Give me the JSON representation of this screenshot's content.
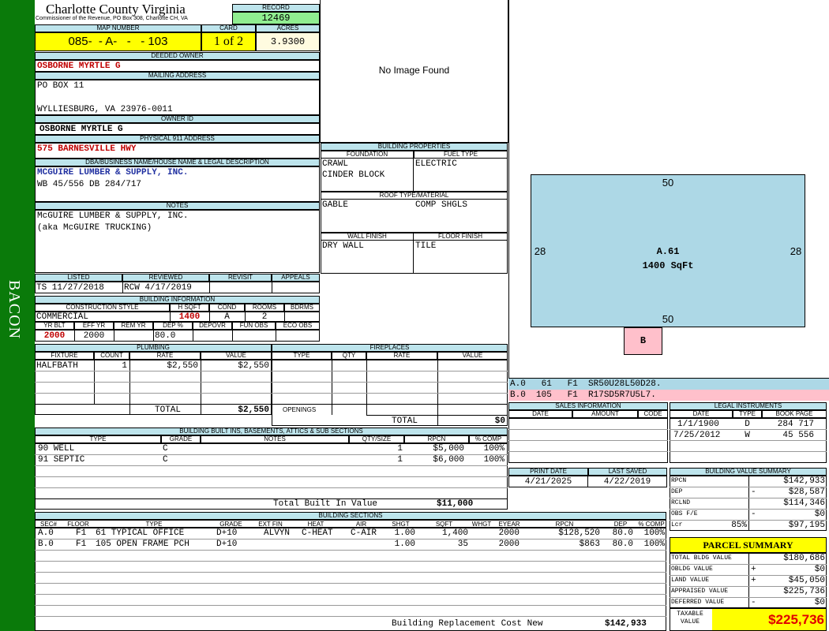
{
  "side_label": "BACON",
  "header": {
    "county": "Charlotte County Virginia",
    "commissioner": "Commissioner of the Revenue, PO Box 308, Charlotte CH, VA",
    "record_label": "RECORD",
    "record": "12469",
    "map_label": "MAP NUMBER",
    "map": "085-  - A-   -   - 103",
    "card_label": "CARD",
    "card": "1 of 2",
    "acres_label": "ACRES",
    "acres": "3.9300"
  },
  "owner": {
    "deeded_label": "DEEDED OWNER",
    "deeded": "OSBORNE MYRTLE G",
    "mailing_label": "MAILING ADDRESS",
    "mailing1": "PO BOX 11",
    "mailing2": "WYLLIESBURG, VA 23976-0011",
    "ownerid_label": "OWNER ID",
    "ownerid": "OSBORNE MYRTLE G",
    "physical_label": "PHYSICAL 911 ADDRESS",
    "physical": "575 BARNESVILLE HWY",
    "dba_label": "DBA/BUSINESS NAME/HOUSE NAME & LEGAL DESCRIPTION",
    "dba": "MCGUIRE LUMBER & SUPPLY, INC.",
    "legal": "WB 45/556 DB 284/717",
    "notes_label": "NOTES",
    "notes1": "McGUIRE LUMBER & SUPPLY, INC.",
    "notes2": "(aka McGUIRE TRUCKING)"
  },
  "image": {
    "no_image": "No Image Found"
  },
  "building_properties": {
    "title": "BUILDING PROPERTIES",
    "foundation_label": "FOUNDATION",
    "foundation1": "CRAWL",
    "foundation2": "CINDER BLOCK",
    "fuel_label": "FUEL TYPE",
    "fuel": "ELECTRIC",
    "roof_label": "ROOF TYPE/MATERIAL",
    "roof_type": "GABLE",
    "roof_material": "COMP SHGLS",
    "wall_label": "WALL FINISH",
    "wall": "DRY WALL",
    "floor_label": "FLOOR FINISH",
    "floor": "TILE"
  },
  "sketch": {
    "top": "50",
    "bottom": "50",
    "left": "28",
    "right": "28",
    "label": "A.61",
    "area": "1400 SqFt",
    "sub_label": "B",
    "line_a": "A.0   61   F1  SR50U28L50D28.",
    "line_b": "B.0  105   F1  R17SD5R7U5L7."
  },
  "review": {
    "listed_label": "LISTED",
    "listed": "TS  11/27/2018",
    "reviewed_label": "REVIEWED",
    "reviewed": "RCW  4/17/2019",
    "revisit_label": "REVISIT",
    "appeals_label": "APPEALS"
  },
  "building_info": {
    "title": "BUILDING INFORMATION",
    "style_label": "CONSTRUCTION STYLE",
    "style": "COMMERCIAL",
    "hsqft_label": "H SQFT",
    "hsqft": "1400",
    "cond_label": "COND",
    "cond": "A",
    "rooms_label": "ROOMS",
    "rooms": "2",
    "bdrms_label": "BDRMS",
    "yrblt_label": "YR BLT",
    "yrblt": "2000",
    "effyr_label": "EFF YR",
    "effyr": "2000",
    "remyr_label": "REM YR",
    "dep_label": "DEP %",
    "dep": "80.0",
    "depovr_label": "DEPOVR",
    "funobs_label": "FUN OBS",
    "ecoobs_label": "ECO OBS"
  },
  "plumbing": {
    "title": "PLUMBING",
    "col_fixture": "FIXTURE",
    "col_count": "COUNT",
    "col_rate": "RATE",
    "col_value": "VALUE",
    "row_fixture": "HALFBATH",
    "row_count": "1",
    "row_rate": "$2,550",
    "row_value": "$2,550",
    "total_label": "TOTAL",
    "total": "$2,550"
  },
  "fireplaces": {
    "title": "FIREPLACES",
    "col_type": "TYPE",
    "col_qty": "QTY",
    "col_rate": "RATE",
    "col_value": "VALUE",
    "openings_label": "OPENINGS",
    "total_label": "TOTAL",
    "total": "$0"
  },
  "sales": {
    "title": "SALES INFORMATION",
    "col_date": "DATE",
    "col_amount": "AMOUNT",
    "col_code": "CODE"
  },
  "legal_instruments": {
    "title": "LEGAL INSTRUMENTS",
    "col_date": "DATE",
    "col_type": "TYPE",
    "col_book": "BOOK PAGE",
    "rows": [
      {
        "date": "1/1/1900",
        "type": "D",
        "book": "284 717"
      },
      {
        "date": "7/25/2012",
        "type": "W",
        "book": "45 556"
      }
    ]
  },
  "builtins": {
    "title": "BUILDING BUILT INS, BASEMENTS, ATTICS & SUB SECTIONS",
    "col_type": "TYPE",
    "col_grade": "GRADE",
    "col_notes": "NOTES",
    "col_qty": "QTY/SIZE",
    "col_rpcn": "RPCN",
    "col_comp": "% COMP",
    "rows": [
      {
        "type": "90 WELL",
        "grade": "C",
        "qty": "1",
        "rpcn": "$5,000",
        "comp": "100%"
      },
      {
        "type": "91 SEPTIC",
        "grade": "C",
        "qty": "1",
        "rpcn": "$6,000",
        "comp": "100%"
      }
    ],
    "total_label": "Total Built In Value",
    "total": "$11,000"
  },
  "print": {
    "print_label": "PRINT DATE",
    "print_date": "4/21/2025",
    "saved_label": "LAST SAVED",
    "saved_date": "4/22/2019"
  },
  "value_summary": {
    "title": "BUILDING VALUE SUMMARY",
    "rpcn_label": "RPCN",
    "rpcn": "$142,933",
    "dep_label": "DEP",
    "dep_sign": "-",
    "dep": "$28,587",
    "rclnd_label": "RCLND",
    "rclnd": "$114,346",
    "obs_label": "OBS F/E",
    "obs_sign": "-",
    "obs": "$0",
    "lcr_label": "Lcr",
    "lcr_pct": "85%",
    "lcr": "$97,195"
  },
  "parcel_summary": {
    "title": "PARCEL SUMMARY",
    "bldg_label": "TOTAL BLDG VALUE",
    "bldg": "$180,686",
    "obldg_label": "OBLDG VALUE",
    "obldg_sign": "+",
    "obldg": "$0",
    "land_label": "LAND VALUE",
    "land_sign": "+",
    "land": "$45,050",
    "appraised_label": "APPRAISED VALUE",
    "appraised": "$225,736",
    "deferred_label": "DEFERRED VALUE",
    "deferred_sign": "-",
    "deferred": "$0",
    "taxable_label1": "TAXABLE",
    "taxable_label2": "VALUE",
    "taxable": "$225,736"
  },
  "sections": {
    "title": "BUILDING SECTIONS",
    "cols": [
      "SEC#",
      "FLOOR",
      "TYPE",
      "GRADE",
      "EXT FIN",
      "HEAT",
      "AIR",
      "SHGT",
      "SQFT",
      "WHGT",
      "EYEAR",
      "RPCN",
      "DEP",
      "% COMP"
    ],
    "rows": [
      [
        "A.0",
        "F1",
        "61 TYPICAL OFFICE",
        "D+10",
        "ALVYN",
        "C-HEAT",
        "C-AIR",
        "1.00",
        "1,400",
        "",
        "2000",
        "$128,520",
        "80.0",
        "100%"
      ],
      [
        "B.0",
        "F1",
        "105 OPEN FRAME PCH",
        "D+10",
        "",
        "",
        "",
        "1.00",
        "35",
        "",
        "2000",
        "$863",
        "80.0",
        "100%"
      ]
    ],
    "replacement_label": "Building Replacement Cost New",
    "replacement": "$142,933"
  },
  "colors": {
    "sidebar": "#0a7a0a",
    "header": "#bde4ec",
    "yellow": "#ffff00",
    "green": "#90ee90",
    "sketch": "#add8e6",
    "pink": "#ffc0cb"
  }
}
